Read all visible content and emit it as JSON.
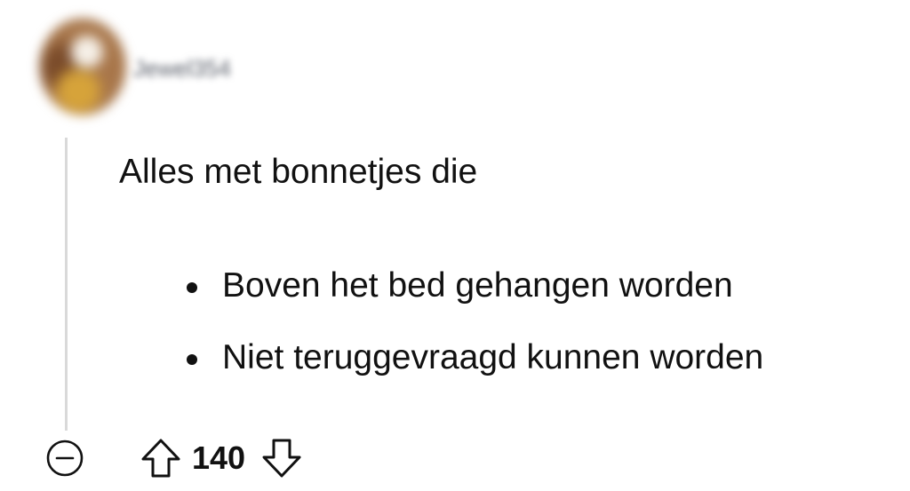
{
  "comment": {
    "author": "Jewel354",
    "body": "Alles met bonnetjes die",
    "bullets": [
      "Boven het bed gehangen worden",
      "Niet teruggevraagd kunnen worden"
    ],
    "score": "140"
  },
  "icons": {
    "collapse": "minus-circle-icon",
    "upvote": "arrow-up-icon",
    "downvote": "arrow-down-icon"
  },
  "colors": {
    "text": "#111111",
    "thread_line": "#d9d9d9",
    "username": "#5a5f6a"
  }
}
